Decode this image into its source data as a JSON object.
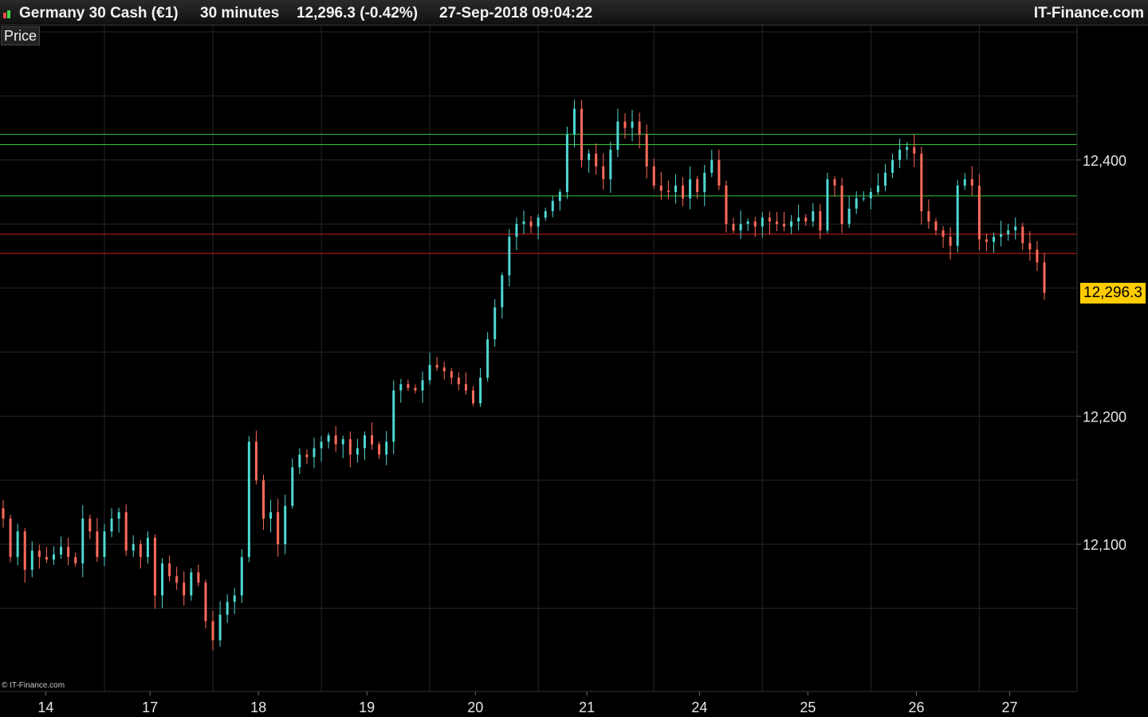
{
  "header": {
    "instrument": "Germany 30 Cash (€1)",
    "timeframe": "30 minutes",
    "last_change": "12,296.3 (-0.42%)",
    "datetime": "27-Sep-2018 09:04:22",
    "brand": "IT-Finance.com"
  },
  "panel_label": "Price",
  "copyright": "© IT-Finance.com",
  "last_price_label": "12,296.3",
  "colors": {
    "up_candle": "#4fd8d2",
    "down_candle": "#ff6b5b",
    "support_line": "#d21e1e",
    "resistance_line": "#32c832",
    "last_price_bg": "#ffcc00",
    "grid": "#262626"
  },
  "chart_data": {
    "type": "candlestick",
    "title": "Germany 30 Cash (€1)",
    "interval": "30 minutes",
    "x_tick_labels": [
      "14",
      "17",
      "18",
      "19",
      "20",
      "21",
      "24",
      "25",
      "26",
      "27"
    ],
    "y_tick_labels": [
      "12,100",
      "12,200",
      "12,400"
    ],
    "y_ticks": [
      12100,
      12200,
      12400
    ],
    "ylim": [
      11985,
      12505
    ],
    "grid": true,
    "horizontal_levels": [
      {
        "value": 12420,
        "color": "green"
      },
      {
        "value": 12412,
        "color": "green"
      },
      {
        "value": 12372,
        "color": "green"
      },
      {
        "value": 12342,
        "color": "red"
      },
      {
        "value": 12327,
        "color": "red"
      }
    ],
    "last_price": 12296.3,
    "change_pct": -0.42,
    "close_path": [
      {
        "day": "14",
        "closes": [
          12120,
          12090,
          12110,
          12080,
          12095,
          12090,
          12088,
          12092,
          12098,
          12090,
          12085,
          12120,
          12110,
          12090
        ]
      },
      {
        "day": "17",
        "closes": [
          12110,
          12120,
          12125,
          12095,
          12100,
          12090,
          12105,
          12060,
          12085,
          12075,
          12070,
          12060,
          12078,
          12070,
          12040
        ]
      },
      {
        "day": "18",
        "closes": [
          12025,
          12045,
          12055,
          12060,
          12090,
          12180,
          12150,
          12120,
          12125,
          12100,
          12130,
          12160,
          12170,
          12168,
          12175
        ]
      },
      {
        "day": "19",
        "closes": [
          12180,
          12185,
          12178,
          12182,
          12170,
          12175,
          12185,
          12178,
          12170,
          12180,
          12220,
          12225,
          12222,
          12220,
          12228
        ]
      },
      {
        "day": "20",
        "closes": [
          12240,
          12238,
          12235,
          12230,
          12225,
          12220,
          12210,
          12230,
          12260,
          12285,
          12310,
          12340,
          12350,
          12352,
          12348
        ]
      },
      {
        "day": "21",
        "closes": [
          12355,
          12360,
          12368,
          12375,
          12420,
          12440,
          12400,
          12405,
          12395,
          12385,
          12408,
          12430,
          12425,
          12430,
          12420,
          12395
        ]
      },
      {
        "day": "24",
        "closes": [
          12380,
          12376,
          12375,
          12380,
          12370,
          12385,
          12375,
          12390,
          12400,
          12380,
          12350,
          12345,
          12350,
          12352,
          12348
        ]
      },
      {
        "day": "25",
        "closes": [
          12355,
          12352,
          12350,
          12348,
          12352,
          12355,
          12352,
          12360,
          12345,
          12385,
          12380,
          12350,
          12362,
          12370,
          12370
        ]
      },
      {
        "day": "26",
        "closes": [
          12375,
          12380,
          12390,
          12400,
          12408,
          12410,
          12405,
          12360,
          12352,
          12345,
          12340,
          12333,
          12380,
          12385,
          12380
        ]
      },
      {
        "day": "27",
        "closes": [
          12338,
          12336,
          12340,
          12342,
          12345,
          12348,
          12335,
          12330,
          12320,
          12296.3
        ]
      }
    ]
  }
}
